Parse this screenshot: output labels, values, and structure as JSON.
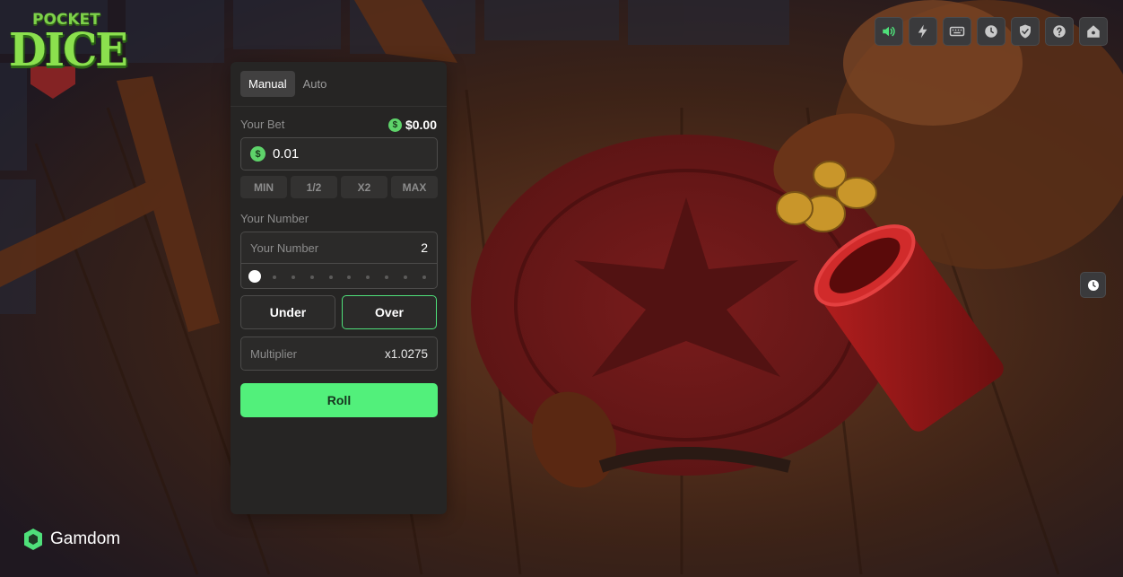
{
  "logo": {
    "line1": "POCKET",
    "line2": "DICE"
  },
  "toolbar": {
    "icons": [
      "speaker-icon",
      "lightning-icon",
      "keyboard-icon",
      "clock-icon",
      "shield-check-icon",
      "help-icon",
      "home-icon"
    ],
    "active_color": "#4fe07a",
    "icon_color": "#c9c9c9"
  },
  "side": {
    "icon": "clock-icon"
  },
  "panel": {
    "tabs": [
      {
        "label": "Manual",
        "active": true
      },
      {
        "label": "Auto",
        "active": false
      }
    ],
    "bet": {
      "label": "Your Bet",
      "balance": "$0.00",
      "currency_symbol": "$",
      "value": "0.01"
    },
    "quick_buttons": [
      "MIN",
      "1/2",
      "X2",
      "MAX"
    ],
    "number": {
      "label": "Your Number",
      "placeholder": "Your Number",
      "value": "2",
      "slider_fraction": 0.0
    },
    "direction": {
      "under_label": "Under",
      "over_label": "Over",
      "selected": "Over"
    },
    "multiplier": {
      "placeholder": "Multiplier",
      "value": "x1.0275"
    },
    "roll_label": "Roll"
  },
  "brand": {
    "name": "Gamdom"
  },
  "colors": {
    "accent_green": "#52f07b",
    "panel_bg": "#262524"
  }
}
